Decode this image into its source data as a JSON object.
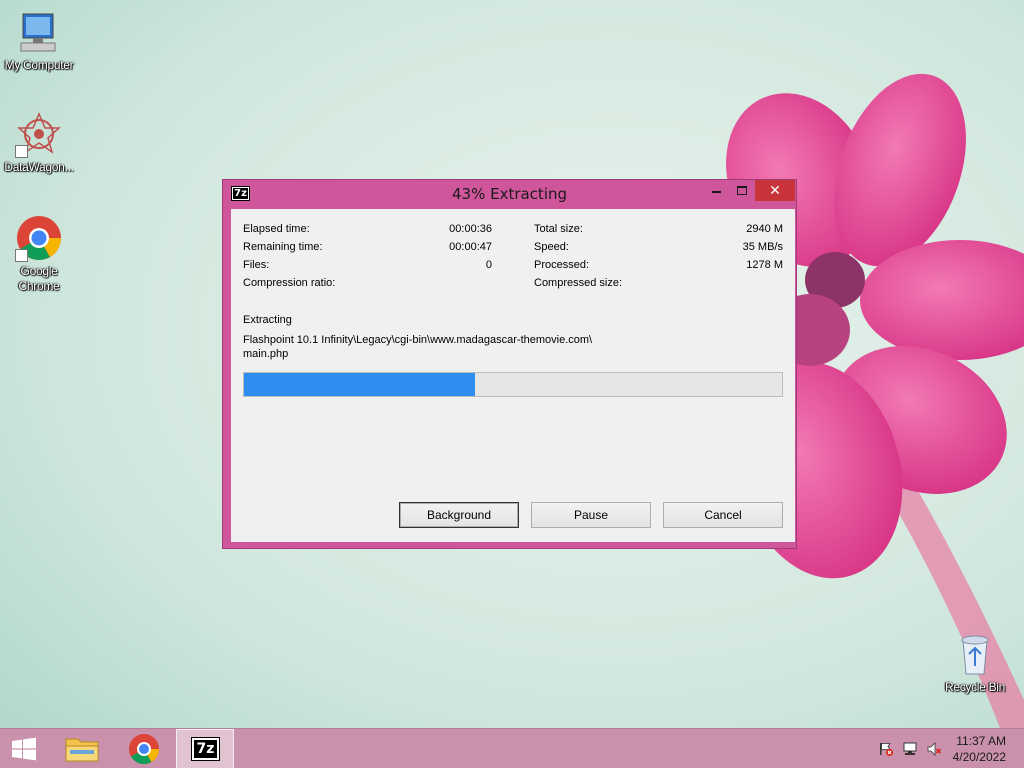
{
  "desktop": {
    "icons": [
      {
        "label": "My Computer"
      },
      {
        "label": "DataWagon..."
      },
      {
        "label": "Google\nChrome"
      },
      {
        "label": "Recycle Bin"
      }
    ]
  },
  "dialog": {
    "app_icon_text": "7z",
    "title": "43% Extracting",
    "close_glyph": "✕",
    "stats_left": [
      {
        "label": "Elapsed time:",
        "value": "00:00:36"
      },
      {
        "label": "Remaining time:",
        "value": "00:00:47"
      },
      {
        "label": "Files:",
        "value": "0"
      },
      {
        "label": "Compression ratio:",
        "value": ""
      }
    ],
    "stats_right": [
      {
        "label": "Total size:",
        "value": "2940 M"
      },
      {
        "label": "Speed:",
        "value": "35 MB/s"
      },
      {
        "label": "Processed:",
        "value": "1278 M"
      },
      {
        "label": "Compressed size:",
        "value": ""
      }
    ],
    "operation": "Extracting",
    "file_path_line1": "Flashpoint 10.1 Infinity\\Legacy\\cgi-bin\\www.madagascar-themovie.com\\",
    "file_path_line2": "main.php",
    "progress_percent": 43,
    "buttons": {
      "background": "Background",
      "pause": "Pause",
      "cancel": "Cancel"
    }
  },
  "taskbar": {
    "seven_zip_label": "7z",
    "clock": {
      "time": "11:37 AM",
      "date": "4/20/2022"
    },
    "colors": {
      "taskbar": "#c991ab",
      "accent": "#d0569b",
      "progress": "#2e8ff0",
      "close": "#c9343a"
    }
  }
}
